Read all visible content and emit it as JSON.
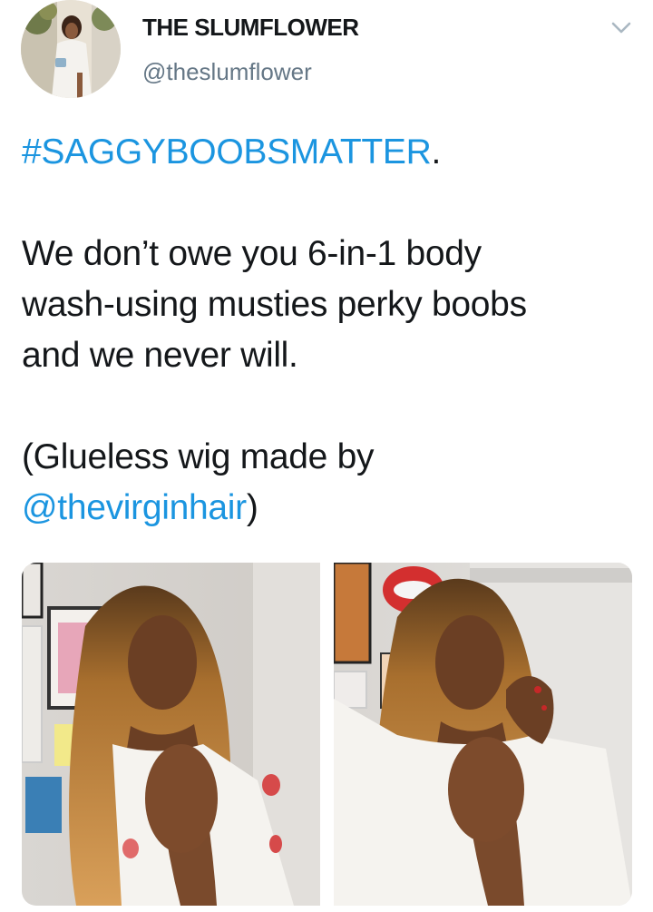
{
  "tweet": {
    "author": {
      "display_name": "THE SLUMFLOWER",
      "handle": "@theslumflower",
      "avatar_icon": "profile-photo"
    },
    "menu_icon": "chevron-down-icon",
    "text": {
      "hashtag": "#SAGGYBOOBSMATTER",
      "hashtag_suffix": ".",
      "line1": "We don’t owe you 6-in-1 body",
      "line2": "wash-using musties perky boobs",
      "line3": "and we never will.",
      "credit_prefix": "(Glueless wig made by",
      "credit_mention": "@thevirginhair",
      "credit_suffix": ")"
    },
    "media": [
      {
        "name": "photo-1",
        "description_icon": "photo"
      },
      {
        "name": "photo-2",
        "description_icon": "photo"
      }
    ]
  },
  "colors": {
    "link": "#1b95e0",
    "text": "#14171a",
    "secondary": "#657786",
    "caret": "#8899a6"
  }
}
